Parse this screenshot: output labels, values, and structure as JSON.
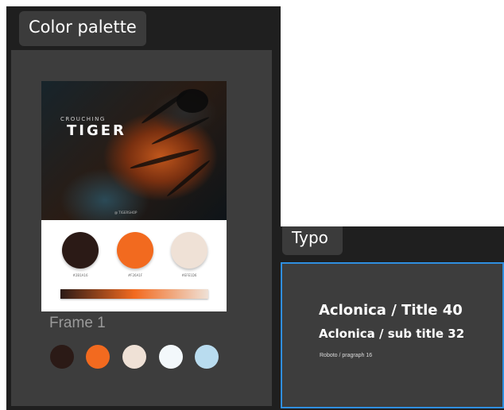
{
  "palette_panel": {
    "tab_label": "Color palette",
    "artboard": {
      "hero_subtitle": "CROUCHING",
      "hero_title": "TIGER",
      "hero_footer": "@ TIGERSHOP",
      "swatches": [
        {
          "color": "#2b1a16",
          "label": "#2B1A16"
        },
        {
          "color": "#f26a1f",
          "label": "#F26A1F"
        },
        {
          "color": "#efe1d6",
          "label": "#EFE1D6"
        }
      ],
      "gradient": [
        "#2b1a16",
        "#f26a1f",
        "#efe1d6"
      ]
    },
    "frame_label": "Frame 1",
    "dots": [
      "#2b1a16",
      "#f26a1f",
      "#efe1d6",
      "#f3f8fb",
      "#b9dcef"
    ]
  },
  "typo_panel": {
    "tab_label": "Typo",
    "title_sample": "Aclonica / Title 40",
    "subtitle_sample": "Aclonica / sub title 32",
    "paragraph_sample": "Roboto / pragraph 16",
    "accent_color": "#2f8fe0"
  }
}
